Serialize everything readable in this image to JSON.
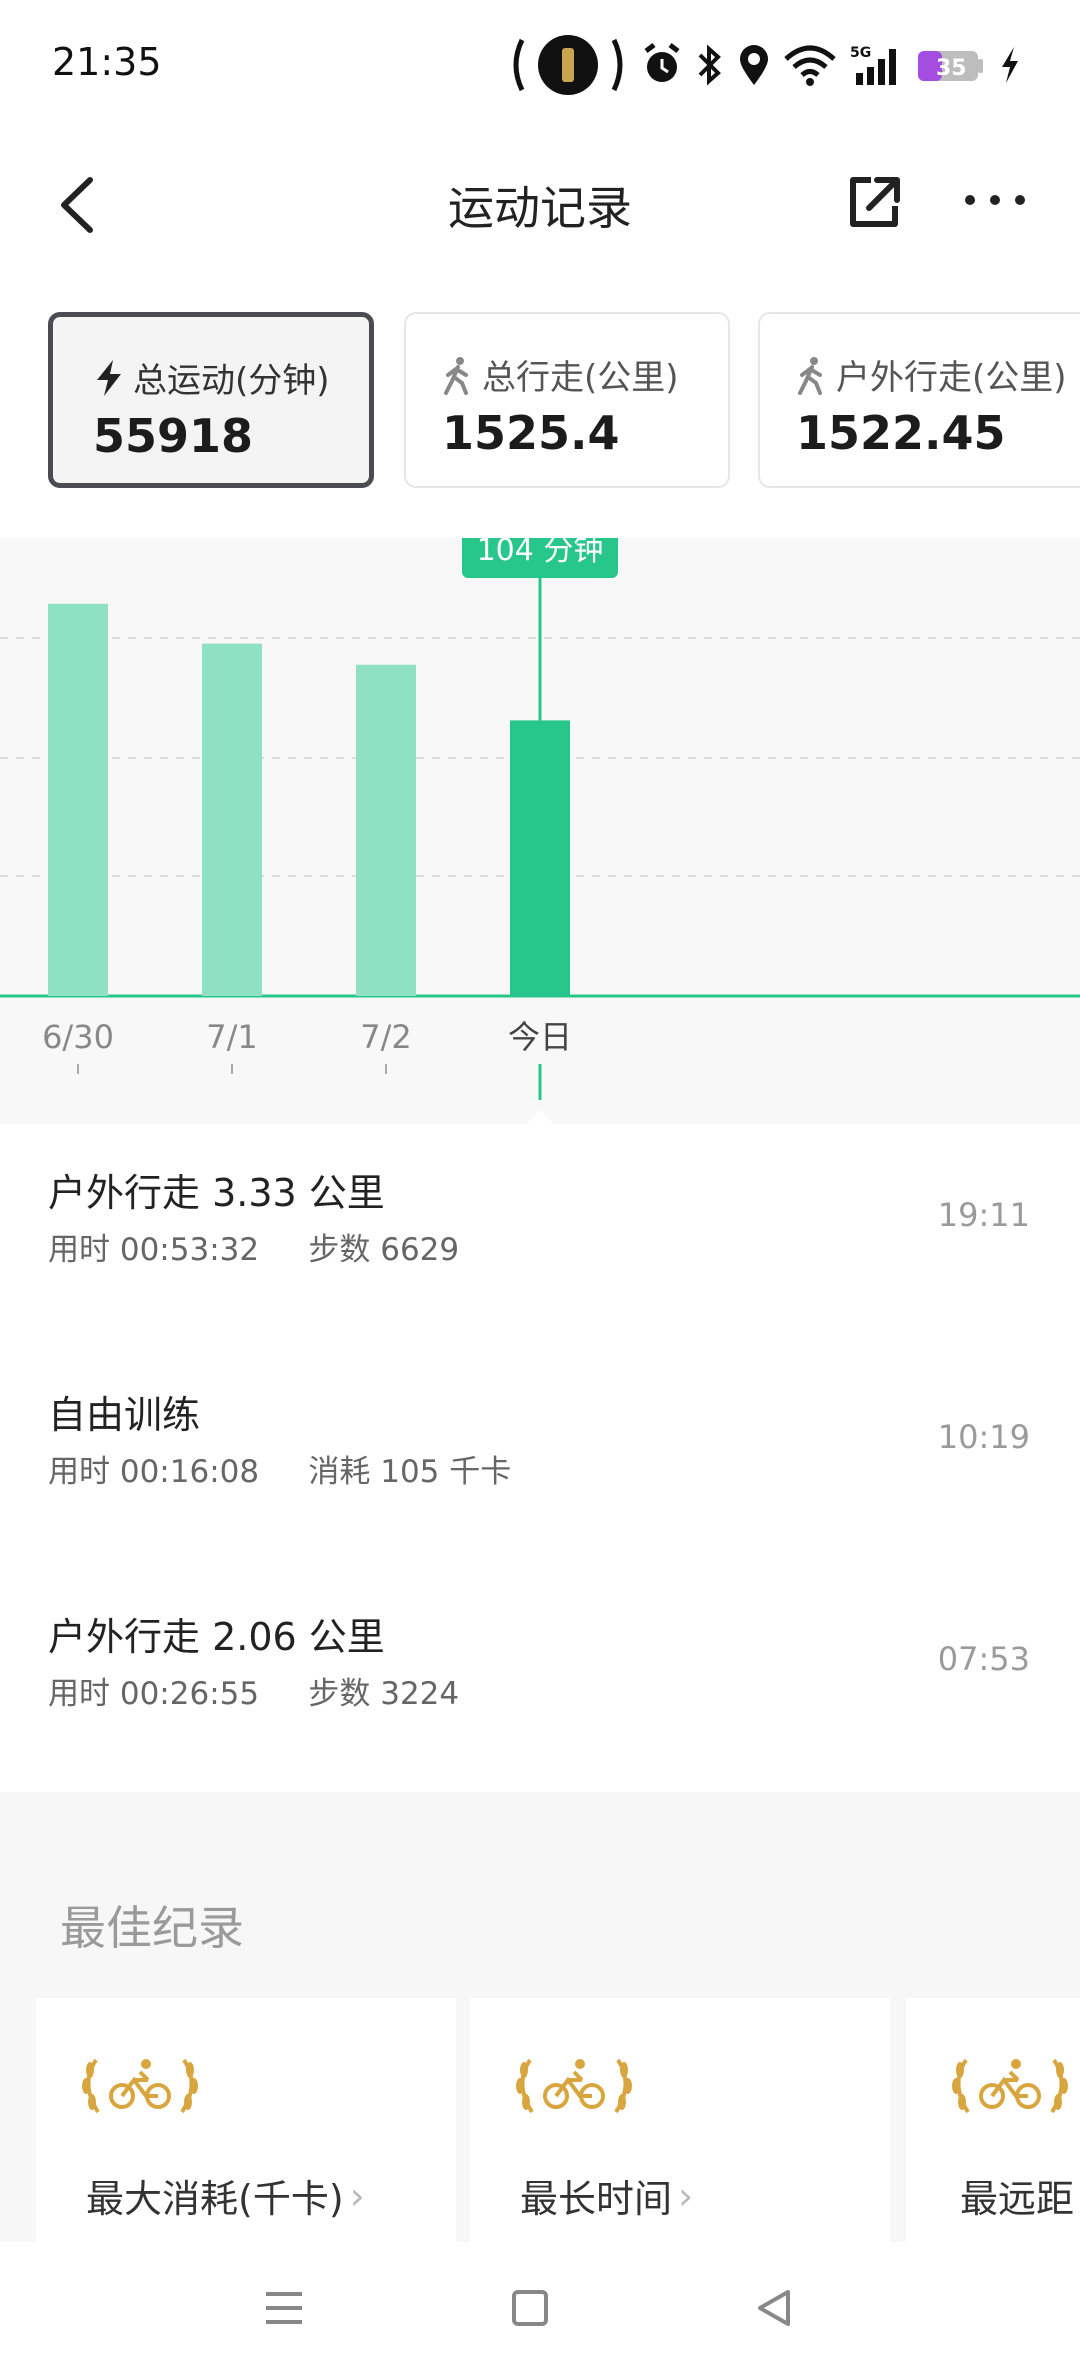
{
  "status_bar": {
    "time": "21:35",
    "battery": "35",
    "network": "5G"
  },
  "header": {
    "title": "运动记录"
  },
  "summary_cards": [
    {
      "label": "总运动(分钟)",
      "value": "55918",
      "icon": "lightning-icon"
    },
    {
      "label": "总行走(公里)",
      "value": "1525.4",
      "icon": "walker-icon"
    },
    {
      "label": "户外行走(公里)",
      "value": "1522.45",
      "icon": "walker-icon"
    }
  ],
  "chart_data": {
    "type": "bar",
    "categories": [
      "6/30",
      "7/1",
      "7/2",
      "今日"
    ],
    "values": [
      148,
      133,
      125,
      104
    ],
    "selected_index": 3,
    "tooltip": "104 分钟",
    "ylim": [
      0,
      160
    ],
    "grid": true,
    "colors": {
      "bar": "#8fe2c1",
      "selected": "#27c68a",
      "axis": "#27c68a"
    }
  },
  "records": [
    {
      "title": "户外行走 3.33 公里",
      "sub1": "用时 00:53:32",
      "sub2": "步数 6629",
      "time": "19:11"
    },
    {
      "title": "自由训练",
      "sub1": "用时 00:16:08",
      "sub2": "消耗 105 千卡",
      "time": "10:19"
    },
    {
      "title": "户外行走 2.06 公里",
      "sub1": "用时 00:26:55",
      "sub2": "步数 3224",
      "time": "07:53"
    }
  ],
  "best_records": {
    "title": "最佳纪录",
    "items": [
      {
        "label": "最大消耗(千卡)"
      },
      {
        "label": "最长时间"
      },
      {
        "label": "最远距"
      }
    ]
  },
  "colors": {
    "accent": "#27c68a",
    "gold": "#d9a53f"
  }
}
